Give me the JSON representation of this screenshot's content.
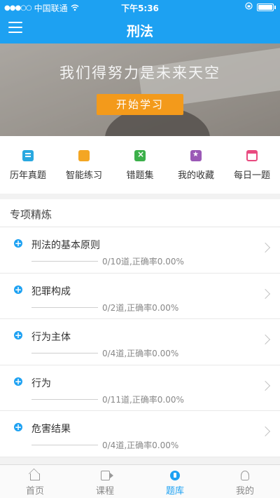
{
  "status_bar": {
    "signal": "●●●○○",
    "carrier": "中国联通",
    "wifi_icon": "wifi-icon",
    "time": "下午5:36",
    "battery_icon": "battery-icon"
  },
  "nav": {
    "title": "刑法",
    "menu_icon": "menu-icon"
  },
  "banner": {
    "slogan": "我们得努力是未来天空",
    "start_button": "开始学习"
  },
  "quick_actions": [
    {
      "label": "历年真题",
      "icon": "past-papers-icon"
    },
    {
      "label": "智能练习",
      "icon": "smart-practice-icon"
    },
    {
      "label": "错题集",
      "icon": "wrong-questions-icon"
    },
    {
      "label": "我的收藏",
      "icon": "favorites-icon"
    },
    {
      "label": "每日一题",
      "icon": "daily-question-icon"
    }
  ],
  "section": {
    "title": "专项精炼"
  },
  "topics": [
    {
      "name": "刑法的基本原则",
      "stat": "0/10道,正确率0.00%",
      "progress": 0
    },
    {
      "name": "犯罪构成",
      "stat": "0/2道,正确率0.00%",
      "progress": 0
    },
    {
      "name": "行为主体",
      "stat": "0/4道,正确率0.00%",
      "progress": 0
    },
    {
      "name": "行为",
      "stat": "0/11道,正确率0.00%",
      "progress": 0
    },
    {
      "name": "危害结果",
      "stat": "0/4道,正确率0.00%",
      "progress": 0
    }
  ],
  "tabbar": [
    {
      "label": "首页",
      "icon": "home-icon",
      "active": false
    },
    {
      "label": "课程",
      "icon": "video-icon",
      "active": false
    },
    {
      "label": "题库",
      "icon": "question-bank-icon",
      "active": true
    },
    {
      "label": "我的",
      "icon": "user-icon",
      "active": false
    }
  ],
  "colors": {
    "primary": "#1da1f2",
    "accent": "#f39a1b"
  }
}
